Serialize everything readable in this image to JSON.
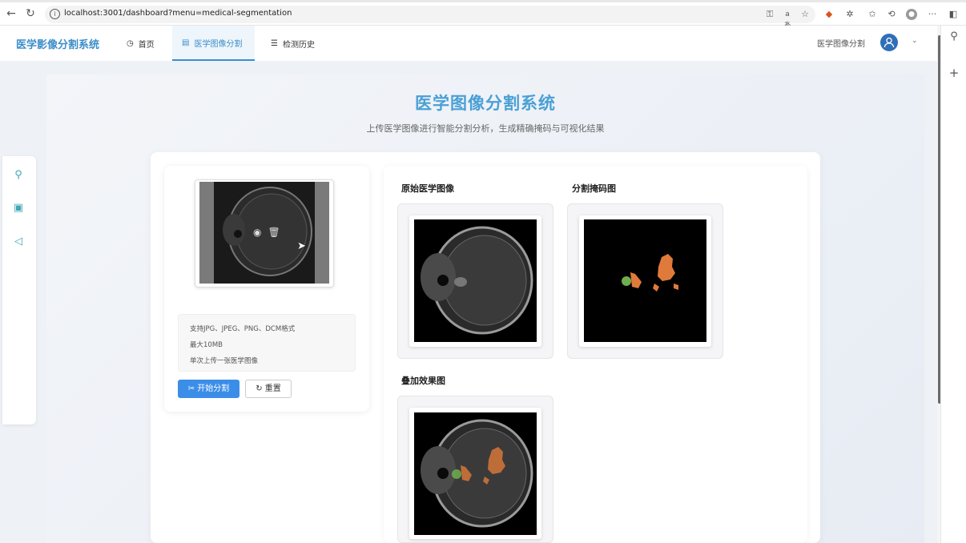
{
  "browser": {
    "url": "localhost:3001/dashboard?menu=medical-segmentation",
    "nav_icons": [
      "back-icon",
      "refresh-icon"
    ],
    "toolbar_icons": [
      "key-icon",
      "read-aloud-icon",
      "favorite-star-icon",
      "extension-icon",
      "puzzle-icon",
      "favorites-icon",
      "history-icon",
      "profile-icon",
      "more-icon",
      "sidebar-icon"
    ]
  },
  "app": {
    "brand": "医学影像分割系统",
    "nav": [
      {
        "label": "首页",
        "icon": "clock-icon"
      },
      {
        "label": "医学图像分割",
        "icon": "document-icon"
      },
      {
        "label": "检测历史",
        "icon": "list-icon"
      }
    ],
    "active_nav": "医学图像分割",
    "header_right": "医学图像分割",
    "accent": "#3b8ec9"
  },
  "page": {
    "title": "医学图像分割系统",
    "subtitle": "上传医学图像进行智能分割分析，生成精确掩码与可视化结果"
  },
  "upload": {
    "tips": [
      "支持JPG、JPEG、PNG、DCM格式",
      "最大10MB",
      "单次上传一张医学图像"
    ],
    "start_button": "开始分割",
    "reset_button": "重置"
  },
  "results": {
    "original_label": "原始医学图像",
    "mask_label": "分割掩码图",
    "overlay_label": "叠加效果图",
    "mask_colors": {
      "region_a": "#e07a3a",
      "region_b": "#6fae4e"
    }
  }
}
